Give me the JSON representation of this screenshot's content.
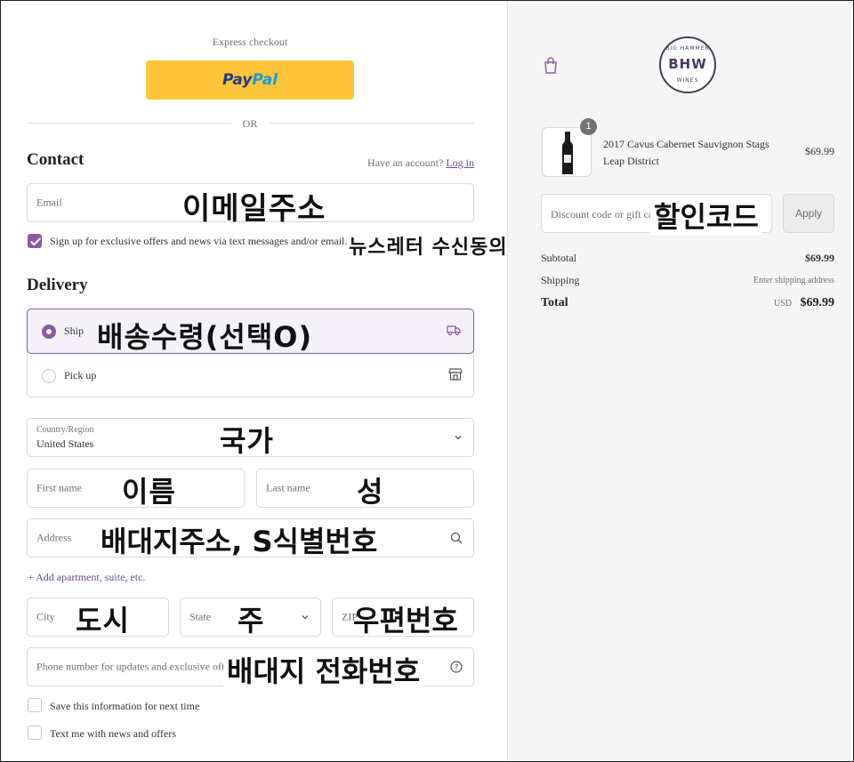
{
  "express": {
    "label": "Express checkout",
    "paypal_part1": "Pay",
    "paypal_part2": "Pal",
    "or": "OR"
  },
  "contact": {
    "heading": "Contact",
    "have_account": "Have an account?",
    "login": "Log in",
    "email_placeholder": "Email",
    "email_annotation": "이메일주소",
    "signup_label": "Sign up for exclusive offers and news via text messages and/or email.",
    "signup_checked": true,
    "signup_annotation": "뉴스레터 수신동의"
  },
  "delivery": {
    "heading": "Delivery",
    "options": [
      {
        "label": "Ship",
        "selected": true,
        "icon": "truck-icon"
      },
      {
        "label": "Pick up",
        "selected": false,
        "icon": "store-icon"
      }
    ],
    "ship_annotation": "배송수령(선택O)",
    "country_label": "Country/Region",
    "country_value": "United States",
    "country_annotation": "국가",
    "first_name_placeholder": "First name",
    "first_name_annotation": "이름",
    "last_name_placeholder": "Last name",
    "last_name_annotation": "성",
    "address_placeholder": "Address",
    "address_annotation": "배대지주소, S식별번호",
    "add_apartment": "Add apartment, suite, etc.",
    "city_placeholder": "City",
    "city_annotation": "도시",
    "state_placeholder": "State",
    "state_annotation": "주",
    "zip_placeholder": "ZIP",
    "zip_annotation": "우편번호",
    "phone_placeholder": "Phone number for updates and exclusive offers",
    "phone_annotation": "배대지 전화번호",
    "save_info_label": "Save this information for next time",
    "text_me_label": "Text me with news and offers"
  },
  "summary": {
    "logo_text": "BHW",
    "logo_top": "BIG HAMMER",
    "logo_bottom": "WINES",
    "quantity": "1",
    "product_name": "2017 Cavus Cabernet Sauvignon Stags Leap District",
    "product_price": "$69.99",
    "discount_placeholder": "Discount code or gift card",
    "discount_annotation": "할인코드",
    "apply": "Apply",
    "subtotal_label": "Subtotal",
    "subtotal_value": "$69.99",
    "shipping_label": "Shipping",
    "shipping_value": "Enter shipping address",
    "total_label": "Total",
    "currency": "USD",
    "total_value": "$69.99"
  },
  "colors": {
    "accent": "#8a5a9f",
    "paypal_yellow": "#ffc439",
    "sidebar_bg": "#f5f5f5"
  }
}
